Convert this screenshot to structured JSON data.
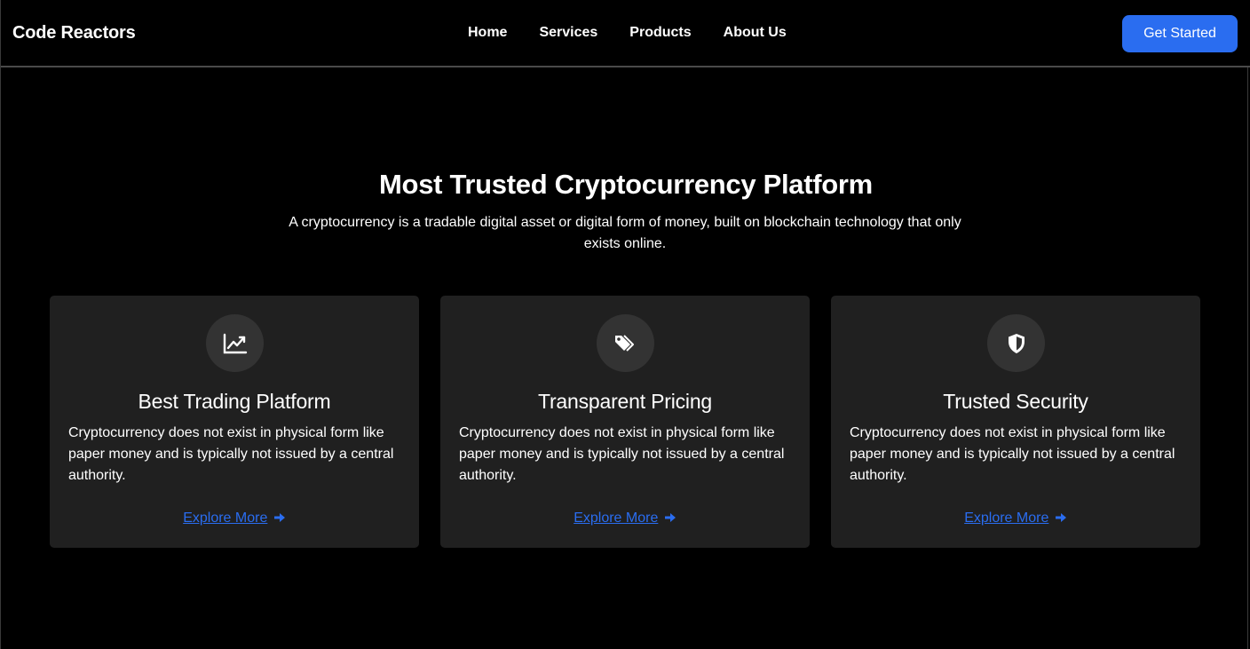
{
  "brand": "Code Reactors",
  "nav": {
    "items": [
      "Home",
      "Services",
      "Products",
      "About Us"
    ],
    "cta_label": "Get Started"
  },
  "hero": {
    "title": "Most Trusted Cryptocurrency Platform",
    "subtitle": "A cryptocurrency is a tradable digital asset or digital form of money, built on blockchain technology that only exists online."
  },
  "cards": [
    {
      "icon": "chart-line-icon",
      "title": "Best Trading Platform",
      "text": "Cryptocurrency does not exist in physical form like paper money and is typically not issued by a central authority.",
      "link": "Explore More"
    },
    {
      "icon": "tags-icon",
      "title": "Transparent Pricing",
      "text": "Cryptocurrency does not exist in physical form like paper money and is typically not issued by a central authority.",
      "link": "Explore More"
    },
    {
      "icon": "shield-icon",
      "title": "Trusted Security",
      "text": "Cryptocurrency does not exist in physical form like paper money and is typically not issued by a central authority.",
      "link": "Explore More"
    }
  ],
  "colors": {
    "background": "#000000",
    "card": "#202020",
    "accent": "#2a6df0"
  }
}
